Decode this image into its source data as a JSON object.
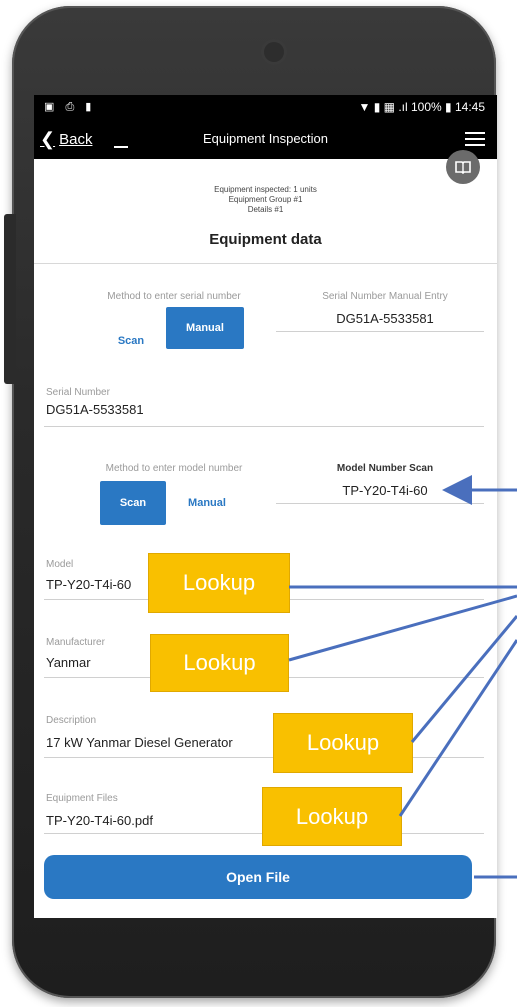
{
  "status_bar": {
    "left_icons": "▣ ⎙ ▮",
    "right_text": "▼ ▮ ▦ .ıl 100% ▮ 14:45"
  },
  "app_bar": {
    "back_label": "Back",
    "title": "Equipment Inspection",
    "menu_icon": "hamburger-icon"
  },
  "header": {
    "meta_line_1": "Equipment inspected: 1 units",
    "meta_line_2": "Equipment Group #1",
    "meta_line_3": "Details #1",
    "section_title": "Equipment data",
    "book_icon": "book-icon"
  },
  "serial_method": {
    "label": "Method to enter serial number",
    "scan_label": "Scan",
    "manual_label": "Manual",
    "selected": "Manual"
  },
  "serial_manual_entry": {
    "label": "Serial Number Manual Entry",
    "value": "DG51A-5533581"
  },
  "serial_number": {
    "label": "Serial Number",
    "value": "DG51A-5533581"
  },
  "model_method": {
    "label": "Method to enter model number",
    "scan_label": "Scan",
    "manual_label": "Manual",
    "selected": "Scan"
  },
  "model_number_scan": {
    "label": "Model Number Scan",
    "value": "TP-Y20-T4i-60"
  },
  "model": {
    "label": "Model",
    "value": "TP-Y20-T4i-60"
  },
  "manufacturer": {
    "label": "Manufacturer",
    "value": "Yanmar"
  },
  "description": {
    "label": "Description",
    "value": "17 kW Yanmar Diesel Generator"
  },
  "equipment_files": {
    "label": "Equipment Files",
    "value": "TP-Y20-T4i-60.pdf"
  },
  "open_file_label": "Open File",
  "annotations": {
    "lookup_label": "Lookup",
    "lookup_color": "#f9c000",
    "arrow_color": "#4a6fbd"
  }
}
